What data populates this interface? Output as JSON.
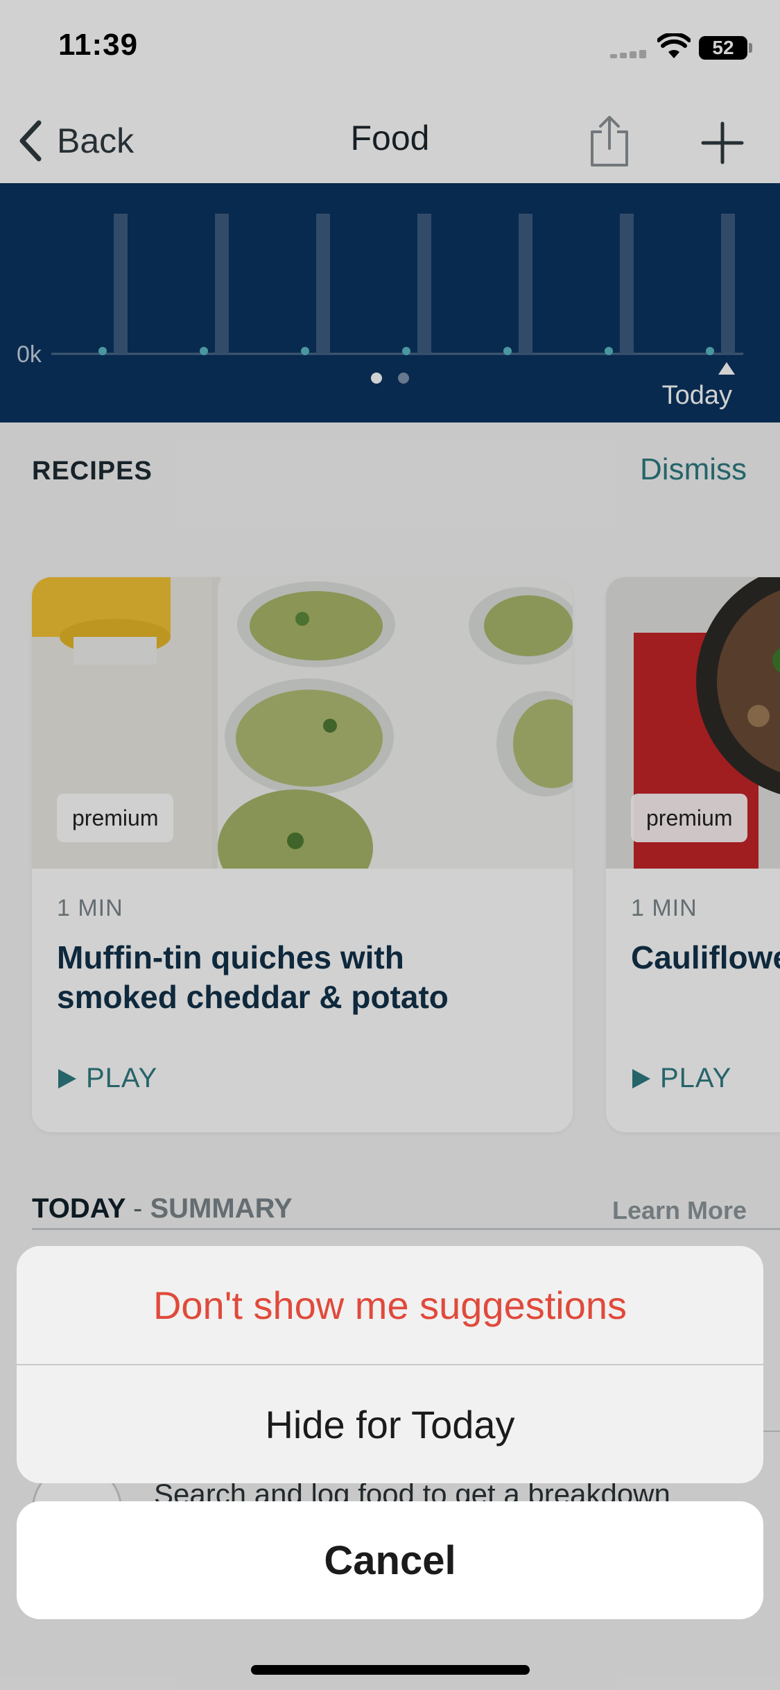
{
  "status_bar": {
    "time": "11:39",
    "battery": "52"
  },
  "nav": {
    "back_label": "Back",
    "title": "Food"
  },
  "chart_data": {
    "type": "bar",
    "categories": [
      "",
      "",
      "",
      "",
      "",
      "",
      "Today"
    ],
    "values": [
      0,
      0,
      0,
      0,
      0,
      0,
      0
    ],
    "y_tick_labels": [
      "0k"
    ],
    "x_label_today": "Today",
    "page_dots": 2,
    "active_page": 0,
    "colors": {
      "background": "#0c3461",
      "bar": "#3c5c80",
      "dot": "#5bb9c4",
      "baseline": "#4f6c8c"
    }
  },
  "recipes": {
    "title": "RECIPES",
    "dismiss": "Dismiss",
    "cards": [
      {
        "badge": "premium",
        "duration": "1 MIN",
        "title_line1": "Muffin-tin quiches with",
        "title_line2": "smoked cheddar & potato",
        "play": "PLAY"
      },
      {
        "badge": "premium",
        "duration": "1 MIN",
        "title_line1": "Cauliflowe",
        "title_line2": "",
        "play": "PLAY"
      }
    ]
  },
  "today": {
    "title": "TODAY",
    "dash": "-",
    "summary": "SUMMARY",
    "learn_more": "Learn More",
    "hint": "Search and log food to get a breakdown"
  },
  "action_sheet": {
    "option_destructive": "Don't show me suggestions",
    "option_hide": "Hide for Today",
    "cancel": "Cancel",
    "colors": {
      "destructive": "#e04a3b"
    }
  }
}
